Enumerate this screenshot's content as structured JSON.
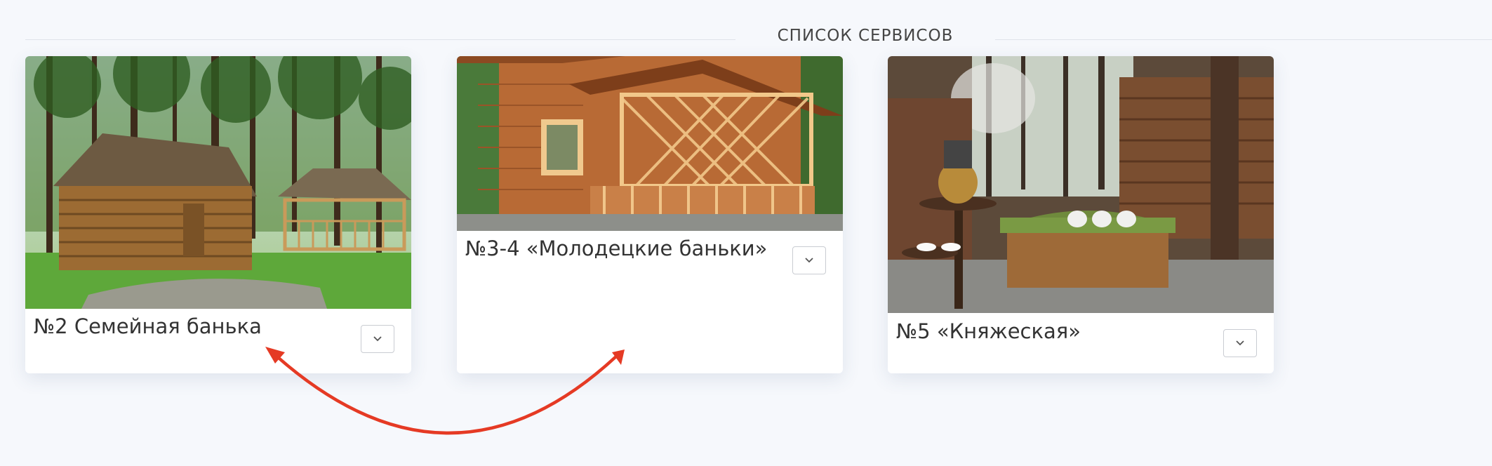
{
  "section": {
    "title": "СПИСОК СЕРВИСОВ"
  },
  "services": [
    {
      "title": "№2 Семейная банька",
      "expand_icon": "chevron-down-icon"
    },
    {
      "title": "№3-4 «Молодецкие баньки»",
      "expand_icon": "chevron-down-icon"
    },
    {
      "title": "№5 «Княжеская»",
      "expand_icon": "chevron-down-icon"
    }
  ],
  "colors": {
    "accent_arrow": "#e53a24",
    "background": "#f6f8fc",
    "card": "#ffffff"
  }
}
